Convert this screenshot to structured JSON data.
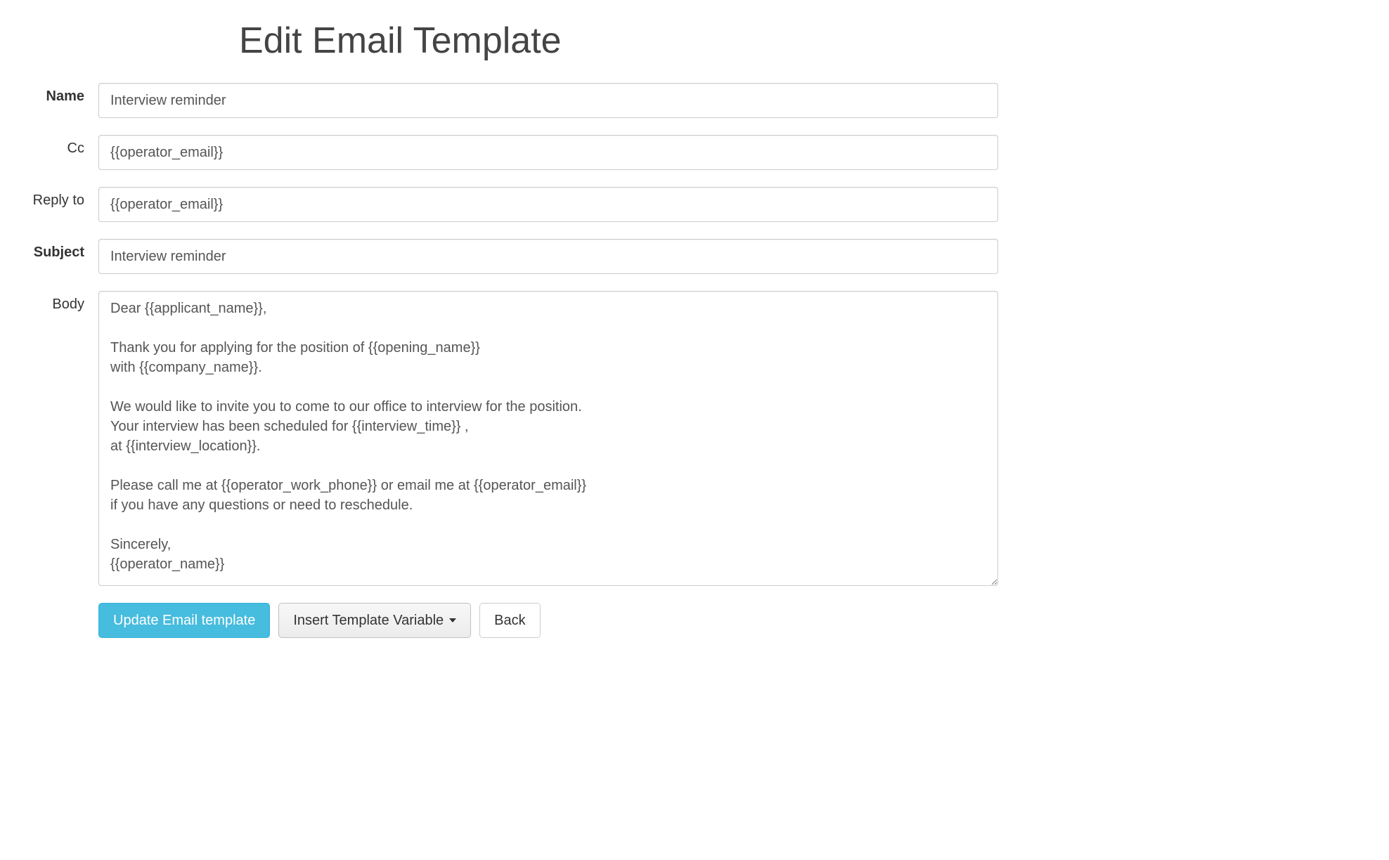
{
  "title": "Edit Email Template",
  "labels": {
    "name": "Name",
    "cc": "Cc",
    "reply_to": "Reply to",
    "subject": "Subject",
    "body": "Body"
  },
  "fields": {
    "name": "Interview reminder",
    "cc": "{{operator_email}}",
    "reply_to": "{{operator_email}}",
    "subject": "Interview reminder",
    "body": "Dear {{applicant_name}},\n\nThank you for applying for the position of {{opening_name}}\nwith {{company_name}}.\n\nWe would like to invite you to come to our office to interview for the position.\nYour interview has been scheduled for {{interview_time}} ,\nat {{interview_location}}.\n\nPlease call me at {{operator_work_phone}} or email me at {{operator_email}}\nif you have any questions or need to reschedule.\n\nSincerely,\n{{operator_name}}"
  },
  "buttons": {
    "update": "Update Email template",
    "insert_variable": "Insert Template Variable",
    "back": "Back"
  }
}
